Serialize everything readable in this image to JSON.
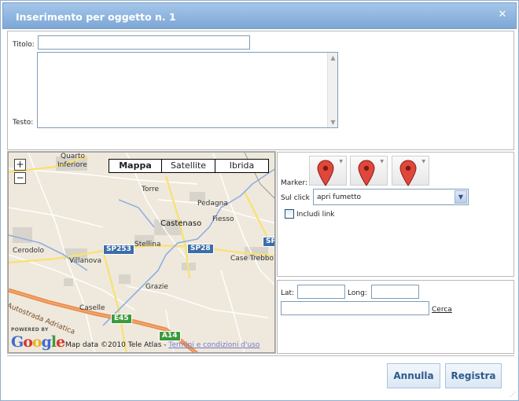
{
  "dialog": {
    "title": "Inserimento per oggetto n. 1",
    "close_glyph": "✕"
  },
  "form": {
    "title_label": "Titolo:",
    "title_value": "",
    "text_label": "Testo:",
    "text_value": ""
  },
  "map": {
    "types": [
      "Mappa",
      "Satellite",
      "Ibrida"
    ],
    "selected_type": "Mappa",
    "zoom_in": "+",
    "zoom_out": "−",
    "places": [
      "Quarto Inferiore",
      "Torre",
      "Pedagna",
      "Castenaso",
      "Fiesso",
      "Stellina",
      "Cerodolo",
      "Villanova",
      "Case Trebbo",
      "Grazie",
      "Caselle"
    ],
    "place_quarto_1": "Quarto",
    "place_quarto_2": "Inferiore",
    "road_shields": [
      "SP253",
      "SP28",
      "SP",
      "E45",
      "A14"
    ],
    "highway_label": "Autostrada Adriatica",
    "powered_by": "POWERED BY",
    "logo_text": "Google",
    "data_text": "Map data ©2010 Tele Atlas - ",
    "terms_link": "Termini e condizioni d'uso"
  },
  "marker": {
    "label": "Marker:",
    "pins": [
      "red-pin",
      "red-pin",
      "red-pin"
    ],
    "pin_color": "#e0473b",
    "click_label": "Sul click",
    "click_value": "apri fumetto",
    "include_link_label": "Includi link",
    "include_link_checked": false
  },
  "coords": {
    "lat_label": "Lat:",
    "lat_value": "",
    "long_label": "Long:",
    "long_value": "",
    "search_value": "",
    "search_link": "Cerca"
  },
  "footer": {
    "cancel_label": "Annulla",
    "save_label": "Registra"
  },
  "colors": {
    "titlebar": "#8fb3de",
    "button_text": "#2d5a8c"
  }
}
